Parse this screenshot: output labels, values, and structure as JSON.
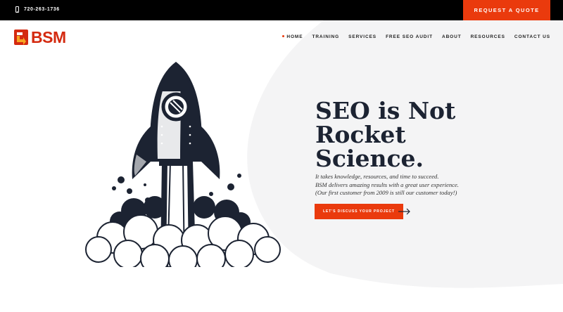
{
  "topbar": {
    "phone": "720-263-1736",
    "quote_button": "REQUEST A QUOTE"
  },
  "brand": {
    "name": "BSM",
    "color": "#d42a10"
  },
  "nav": {
    "items": [
      "HOME",
      "TRAINING",
      "SERVICES",
      "FREE SEO AUDIT",
      "ABOUT",
      "RESOURCES",
      "CONTACT US"
    ],
    "active": "HOME"
  },
  "hero": {
    "title": "SEO is Not\nRocket\nScience.",
    "subtitle_lines": [
      "It takes knowledge, resources, and time to succeed.",
      "BSM delivers amazing results with a great user experience.",
      "(Our first customer from 2009 is still our customer today!)"
    ],
    "cta": "LET'S DISCUSS YOUR PROJECT"
  },
  "colors": {
    "accent": "#ea3a0d",
    "dark": "#1c2332",
    "background_shape": "#f4f4f5"
  },
  "icons": [
    "phone-icon",
    "logo-icon",
    "arrow-right-icon",
    "rocket-illustration"
  ]
}
